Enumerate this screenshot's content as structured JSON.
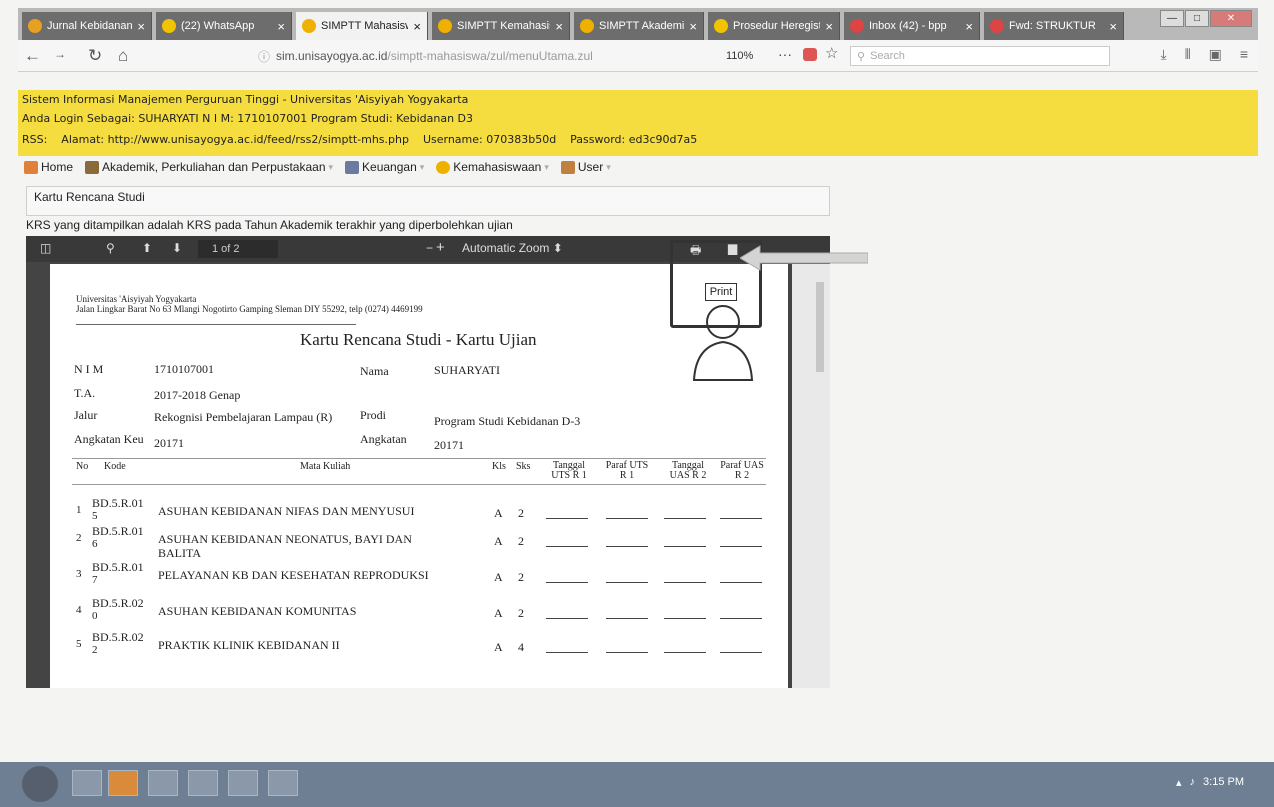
{
  "browser": {
    "tabs": [
      {
        "label": "Jurnal Kebidanan",
        "favicon_color": "#e8a020"
      },
      {
        "label": "(22) WhatsApp",
        "favicon_color": "#f2c300"
      },
      {
        "label": "SIMPTT Mahasiswa",
        "favicon_color": "#f0b000",
        "active": true
      },
      {
        "label": "SIMPTT Kemahasiswaan",
        "favicon_color": "#f0b000"
      },
      {
        "label": "SIMPTT Akademik",
        "favicon_color": "#f0b000"
      },
      {
        "label": "Prosedur Heregistrasi",
        "favicon_color": "#f2c300"
      },
      {
        "label": "Inbox (42) - bpp",
        "favicon_color": "#d44"
      },
      {
        "label": "Fwd: STRUKTUR",
        "favicon_color": "#d44"
      }
    ],
    "close_glyph": "×",
    "url_prefix": "ⓘ",
    "url_host": "sim.unisayogya.ac.id",
    "url_path": "/simptt-mahasiswa/zul/menuUtama.zul",
    "zoom": "110%",
    "more_glyph": "···",
    "search_placeholder": "Search"
  },
  "header": {
    "system_title": "Sistem Informasi Manajemen Perguruan Tinggi - Universitas 'Aisyiyah Yogyakarta",
    "login_line": "Anda Login Sebagai: SUHARYATI    N I M: 1710107001    Program Studi: Kebidanan D3",
    "rss_line": "RSS:    Alamat: http://www.unisayogya.ac.id/feed/rss2/simptt-mhs.php    Username: 070383b50d    Password: ed3c90d7a5"
  },
  "menu": [
    {
      "label": "Home",
      "icon": "home-icon",
      "color": "#e0803a"
    },
    {
      "label": "Akademik, Perkuliahan dan Perpustakaan",
      "icon": "academic-icon",
      "color": "#8a6a3a"
    },
    {
      "label": "Keuangan",
      "icon": "finance-icon",
      "color": "#6a7aa0"
    },
    {
      "label": "Kemahasiswaan",
      "icon": "student-star-icon",
      "color": "#f0b000"
    },
    {
      "label": "User",
      "icon": "user-icon",
      "color": "#c08040"
    }
  ],
  "panel": {
    "title": "Kartu Rencana Studi",
    "note": "KRS yang ditampilkan adalah KRS pada Tahun Akademik terakhir yang diperbolehkan ujian"
  },
  "pdf_toolbar": {
    "page_indicator": "1 of 2",
    "zoom_label": "Automatic Zoom",
    "tooltip": "Print"
  },
  "document": {
    "university": "Universitas 'Aisyiyah Yogyakarta",
    "address": "Jalan Lingkar Barat No 63 Mlangi Nogotirto Gamping Sleman DIY 55292, telp (0274) 4469199",
    "title": "Kartu Rencana Studi - Kartu Ujian",
    "fields": {
      "nim_label": "N I M",
      "nim": "1710107001",
      "nama_label": "Nama",
      "nama": "SUHARYATI",
      "ta_label": "T.A.",
      "ta": "2017-2018 Genap",
      "jalur_label": "Jalur",
      "jalur": "Rekognisi Pembelajaran Lampau (R)",
      "prodi_label": "Prodi",
      "prodi": "Program Studi Kebidanan D-3",
      "angkatan_keu_label": "Angkatan Keu",
      "angkatan_keu": "20171",
      "angkatan_label": "Angkatan",
      "angkatan": "20171"
    },
    "columns": {
      "no": "No",
      "kode": "Kode",
      "matakuliah": "Mata Kuliah",
      "kls": "Kls",
      "sks": "Sks",
      "tanggal_uts": "Tanggal UTS R 1",
      "paraf_uts": "Paraf UTS R 1",
      "tanggal_uas": "Tanggal UAS R 2",
      "paraf_uas": "Paraf UAS R 2"
    },
    "rows": [
      {
        "no": "1",
        "kode1": "BD.5.R.01",
        "kode2": "5",
        "mk1": "ASUHAN KEBIDANAN NIFAS DAN MENYUSUI",
        "mk2": "",
        "kls": "A",
        "sks": "2"
      },
      {
        "no": "2",
        "kode1": "BD.5.R.01",
        "kode2": "6",
        "mk1": "ASUHAN KEBIDANAN NEONATUS, BAYI DAN",
        "mk2": "BALITA",
        "kls": "A",
        "sks": "2"
      },
      {
        "no": "3",
        "kode1": "BD.5.R.01",
        "kode2": "7",
        "mk1": "PELAYANAN KB DAN KESEHATAN REPRODUKSI",
        "mk2": "",
        "kls": "A",
        "sks": "2"
      },
      {
        "no": "4",
        "kode1": "BD.5.R.02",
        "kode2": "0",
        "mk1": "ASUHAN KEBIDANAN KOMUNITAS",
        "mk2": "",
        "kls": "A",
        "sks": "2"
      },
      {
        "no": "5",
        "kode1": "BD.5.R.02",
        "kode2": "2",
        "mk1": "PRAKTIK KLINIK KEBIDANAN II",
        "mk2": "",
        "kls": "A",
        "sks": "4"
      }
    ]
  },
  "taskbar": {
    "time": "3:15 PM"
  }
}
